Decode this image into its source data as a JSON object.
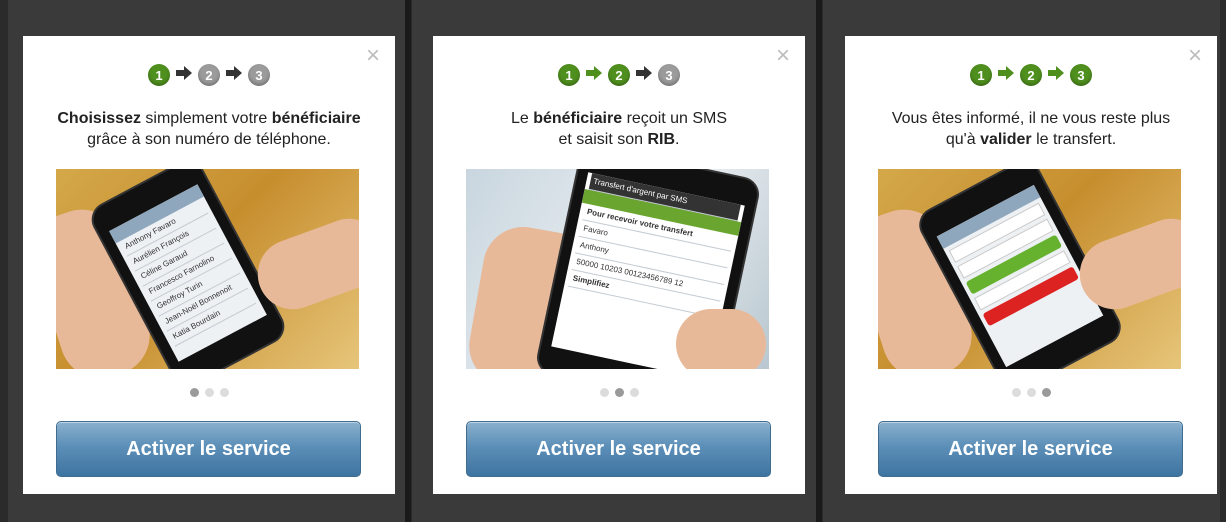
{
  "panels": [
    {
      "steps": [
        "1",
        "2",
        "3"
      ],
      "active_steps": 1,
      "text_html": "<b>Choisissez</b> simplement votre <b>bénéficiaire</b><br>grâce à son numéro de téléphone.",
      "page_index": 0,
      "button_label": "Activer le service",
      "close_label": "×"
    },
    {
      "steps": [
        "1",
        "2",
        "3"
      ],
      "active_steps": 2,
      "text_html": "Le <b>bénéficiaire</b> reçoit un SMS<br>et saisit son <b>RIB</b>.",
      "page_index": 1,
      "button_label": "Activer le service",
      "close_label": "×"
    },
    {
      "steps": [
        "1",
        "2",
        "3"
      ],
      "active_steps": 3,
      "text_html": "Vous êtes informé, il ne vous reste plus<br>qu'à <b>valider</b> le transfert.",
      "page_index": 2,
      "button_label": "Activer le service",
      "close_label": "×"
    }
  ],
  "photo_contents": {
    "p1_rows": [
      "Anthony Favaro",
      "Aurélien François",
      "Céline Garaud",
      "Francesco Farnolino",
      "Geoffroy Turin",
      "Jean-Noël Bonnenoit",
      "Katia Bourdain"
    ],
    "p2_title": "Transfert d'argent par SMS",
    "p2_heading": "Pour recevoir votre transfert",
    "p2_name": "Favaro",
    "p2_firstname": "Anthony",
    "p2_rib": "50000  10203  00123456789  12",
    "p2_footer": "Simplifiez"
  },
  "colors": {
    "step_active": "#4f8f1e",
    "step_inactive": "#9b9b9b",
    "button": "#5c8fb8"
  },
  "icons": {
    "close": "close-icon",
    "arrow": "arrow-right-icon"
  }
}
